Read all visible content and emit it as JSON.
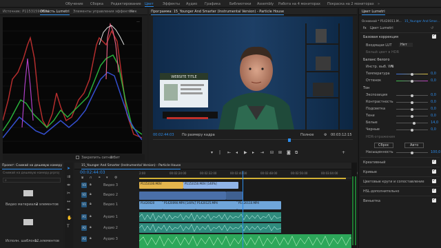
{
  "workspaces": [
    "Обучение",
    "Сборка",
    "Редактирование",
    "Цвет",
    "Эффекты",
    "Аудио",
    "Графика",
    "Библиотеки",
    "Assembly",
    "Работа на 4 мониторах",
    "Покраска на 2 мониторах"
  ],
  "active_workspace": "Цвет",
  "source_panel": {
    "tabs": [
      "Источник: P1153159.MOV",
      "Область Lumetri",
      "Элементы управления эффектом",
      "Мик"
    ],
    "active_tab": "Область Lumetri",
    "scope_label": "8 бит",
    "scope_clamp": "Закрепить сигнал"
  },
  "program_monitor": {
    "title": "Программа: 15_Younger And Smarter (Instrumental Version) - Particle House",
    "timecode_current": "00:02:44:03",
    "fit_label": "По размеру кадра",
    "quality_label": "Полное",
    "timecode_total": "00:03:12:15",
    "monitor_screen_text": "WEBSITE TITLE"
  },
  "project_panel": {
    "title": "Проект: Снимай на дешевую камеру",
    "search_placeholder": "Снимай на дешевую камеру.prproj",
    "items": [
      {
        "name": "Видео материалы",
        "count": "2 элементов"
      },
      {
        "name": "Исполн. шаблона...",
        "count": "12 элементов"
      }
    ]
  },
  "timeline": {
    "tab_label": "15_Younger And Smarter (Instrumental Version) - Particle House",
    "timecode": "00:02:44:03",
    "ruler": [
      "2:00",
      "00:02:24:00",
      "00:02:32:00",
      "00:02:40:00",
      "00:02:48:00",
      "00:02:56:00",
      "00:03:04:00",
      "00:0"
    ],
    "tracks": {
      "video": [
        "Видео 3",
        "Видео 2",
        "Видео 1"
      ],
      "audio": [
        "Аудио 1",
        "Аудио 2",
        "Аудио 3"
      ]
    },
    "clips_v2": [
      "P1153100.MOV",
      "P1153150.MOV [140%]"
    ],
    "clips_v1": [
      "P1420020",
      "P1420090.MP4 [140%]",
      "P1420125.MP4",
      "P1420110.MP4"
    ]
  },
  "lumetri": {
    "tabs": [
      "Цвет Lumetri"
    ],
    "sequence": "Основной * P1420011.M...",
    "clip": "15_Younger And Smar...",
    "effect_name": "Цвет Lumetri",
    "section_basic": "Базовая коррекция",
    "lut_label": "Входящая LUT",
    "lut_value": "Нет",
    "hdr_label": "Белый цвет в HDR",
    "wb_section": "Баланс белого",
    "wb_picker": "Инстр. выб. WB",
    "params_wb": [
      {
        "label": "Температура",
        "value": "0,0",
        "pos": 0.5
      },
      {
        "label": "Оттенок",
        "value": "0,0",
        "pos": 0.5
      }
    ],
    "tone_section": "Тон",
    "params_tone": [
      {
        "label": "Экспозиция",
        "value": "0,0",
        "pos": 0.5
      },
      {
        "label": "Контрастность",
        "value": "0,0",
        "pos": 0.5
      },
      {
        "label": "Подсветка",
        "value": "0,0",
        "pos": 0.5
      },
      {
        "label": "Тени",
        "value": "0,0",
        "pos": 0.5
      },
      {
        "label": "Белые",
        "value": "14,0",
        "pos": 0.57
      },
      {
        "label": "Черные",
        "value": "0,0",
        "pos": 0.5
      }
    ],
    "hdr_highlights": "HDR-отражения",
    "btn_reset": "Сброс",
    "btn_auto": "Авто",
    "saturation_label": "Насыщенность",
    "saturation_value": "100,0",
    "sections": [
      "Креативный",
      "Кривые",
      "Цветовые круги и сопоставление",
      "HSL-дополнительно",
      "Виньетка"
    ]
  },
  "colors": {
    "accent": "#2d8ceb",
    "clip_video_v2": "#8fb4e8",
    "clip_video_v1": "#6fa5d9",
    "clip_audio": "#41b9a0",
    "clip_audio_green": "#46c46b",
    "playhead": "#2d8ceb"
  }
}
